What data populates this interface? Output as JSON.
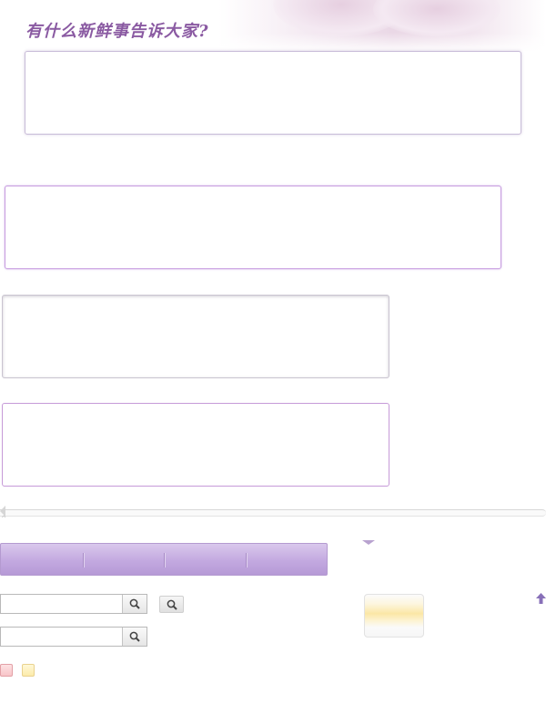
{
  "header": {
    "prompt_title": "有什么新鲜事告诉大家?"
  },
  "text_areas": [
    {
      "value": ""
    },
    {
      "value": ""
    },
    {
      "value": ""
    },
    {
      "value": ""
    }
  ],
  "nav_tabs": [
    {
      "label": ""
    },
    {
      "label": ""
    },
    {
      "label": ""
    },
    {
      "label": ""
    }
  ],
  "search_rows": [
    {
      "value": "",
      "placeholder": ""
    },
    {
      "value": "",
      "placeholder": ""
    }
  ],
  "icons": {
    "search": "search-icon",
    "scroll_top": "arrow-up-icon",
    "dropdown": "chevron-down-icon"
  },
  "colors": {
    "title": "#8a5aa2",
    "tab_bar": "#c3a9e0",
    "box_border_purple": "#c79ce0",
    "swatch_pink": "#f8c4c8",
    "swatch_yellow": "#fcebaa",
    "notice_highlight": "#fbe7a6"
  }
}
